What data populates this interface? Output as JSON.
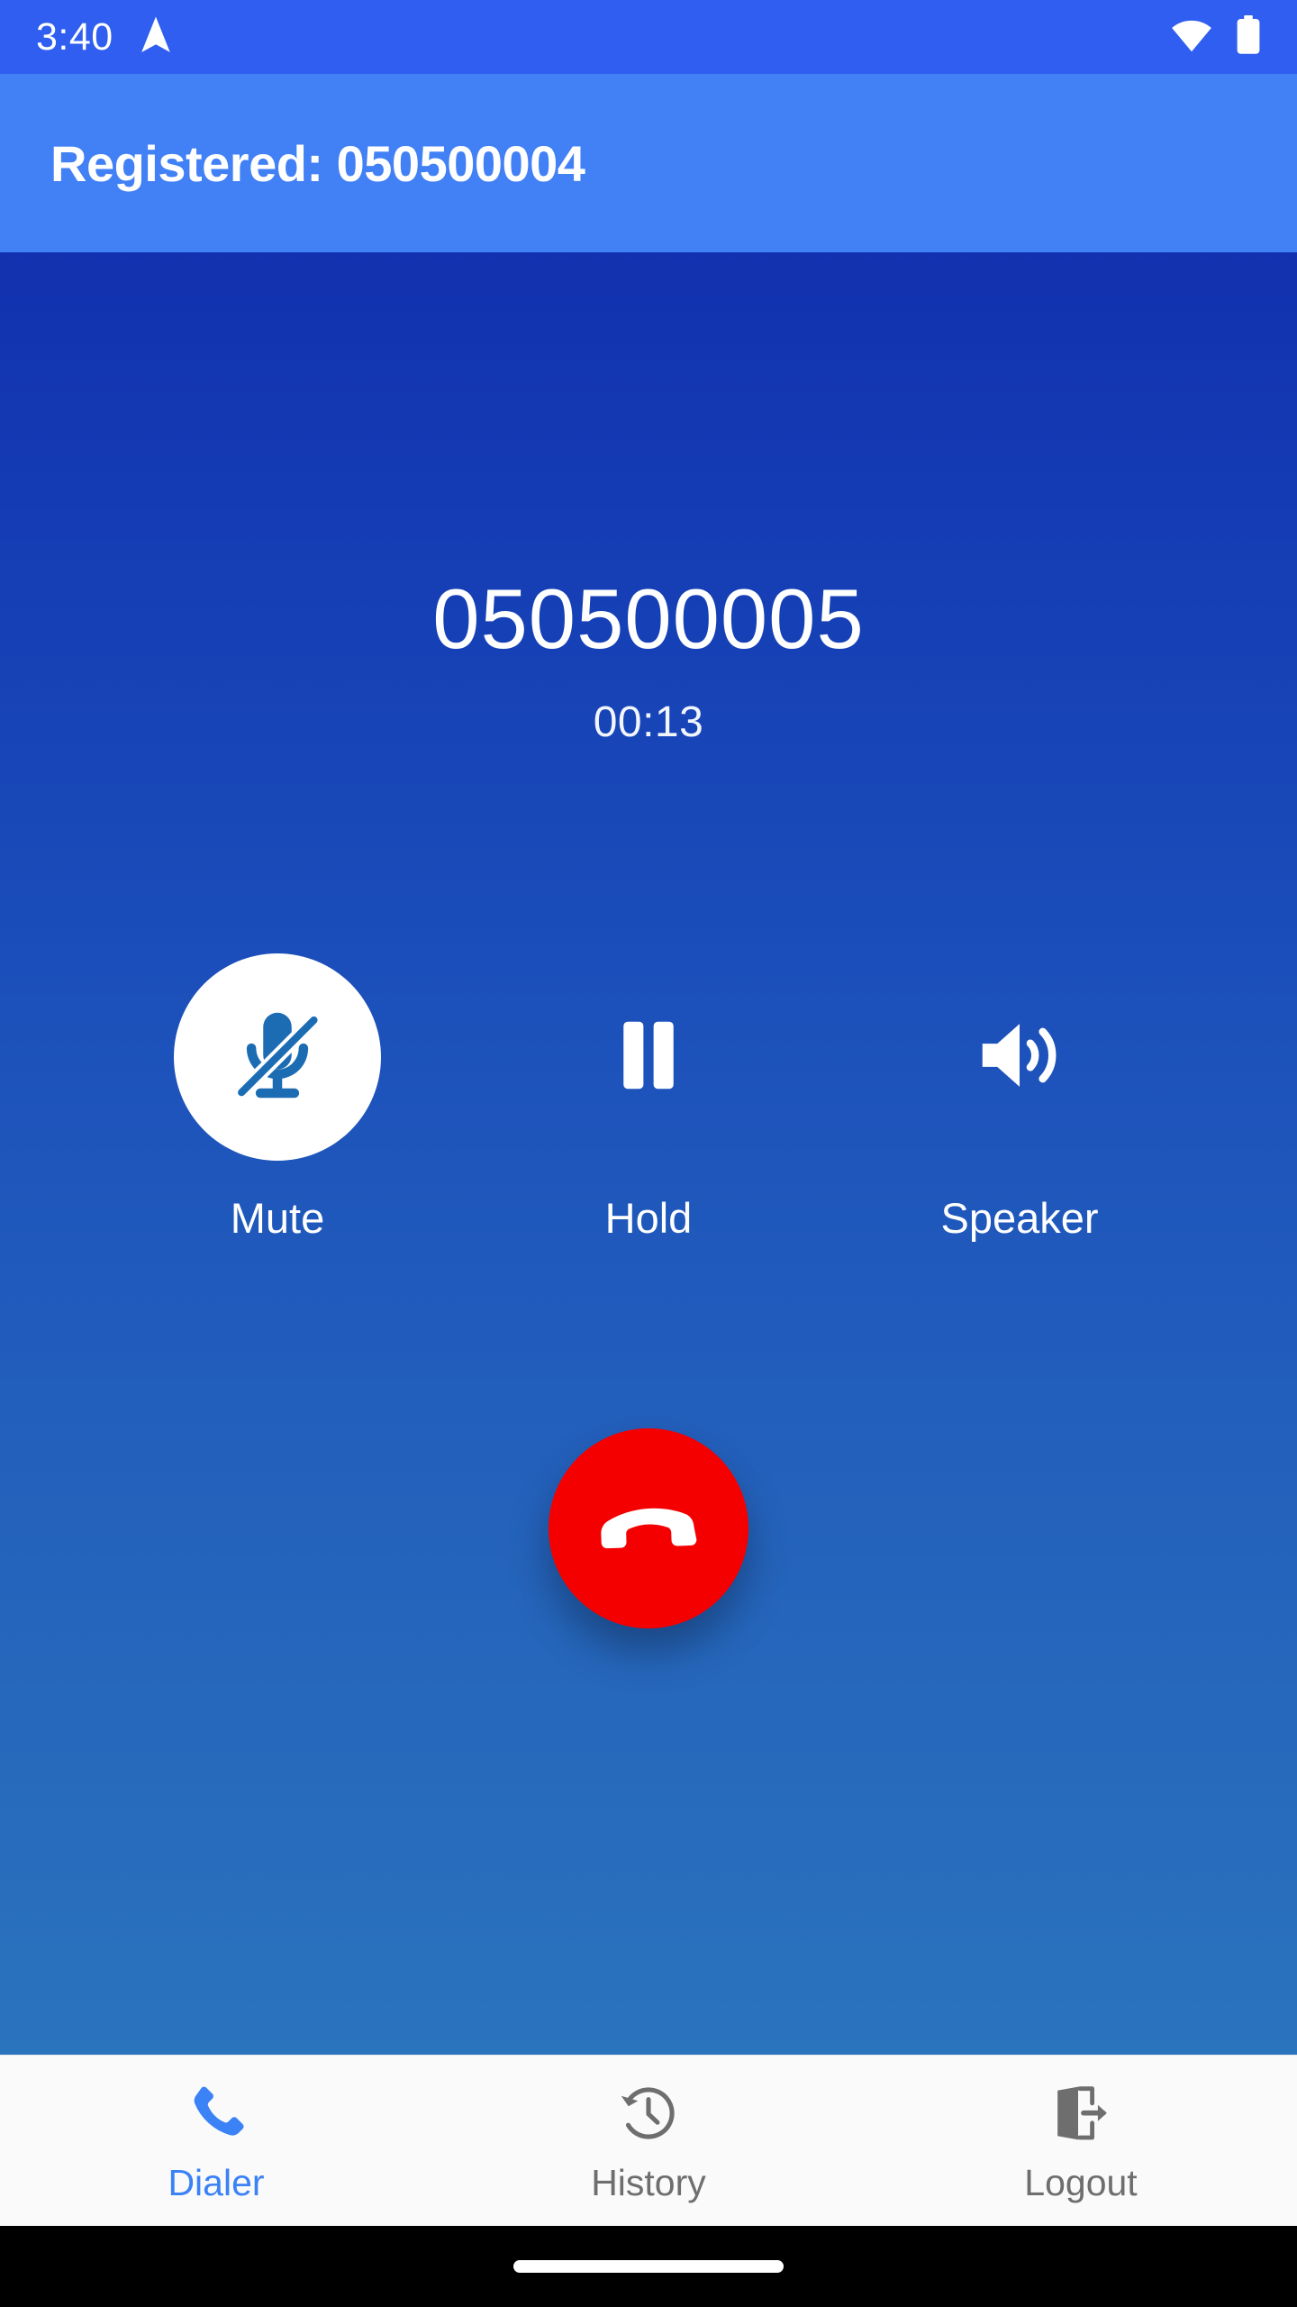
{
  "status_bar": {
    "time": "3:40",
    "icons": [
      "navigation-arrow-icon",
      "wifi-icon",
      "battery-icon"
    ],
    "background_color": "#305ef0"
  },
  "app_bar": {
    "title": "Registered: 050500004",
    "background_color": "#4180f5"
  },
  "call": {
    "number": "050500005",
    "duration": "00:13",
    "background_gradient_top": "#1231b0",
    "background_gradient_bottom": "#2a73bd",
    "controls": [
      {
        "label": "Mute",
        "icon": "mic-off-icon",
        "active": true
      },
      {
        "label": "Hold",
        "icon": "pause-icon",
        "active": false
      },
      {
        "label": "Speaker",
        "icon": "speaker-icon",
        "active": false
      }
    ],
    "end_call": {
      "icon": "call-end-icon",
      "color": "#f50000"
    }
  },
  "bottom_nav": {
    "active_color": "#3b82f6",
    "inactive_color": "#6e6e6e",
    "items": [
      {
        "label": "Dialer",
        "icon": "phone-icon",
        "active": true
      },
      {
        "label": "History",
        "icon": "history-clock-icon",
        "active": false
      },
      {
        "label": "Logout",
        "icon": "logout-door-icon",
        "active": false
      }
    ]
  }
}
